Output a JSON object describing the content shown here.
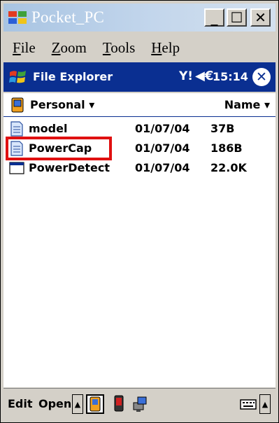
{
  "window": {
    "title": "Pocket_PC",
    "minimize_glyph": "_",
    "maximize_glyph": "☐",
    "close_glyph": "✕"
  },
  "menu": {
    "items": [
      {
        "label": "File",
        "mnemonic": "F",
        "rest": "ile"
      },
      {
        "label": "Zoom",
        "mnemonic": "Z",
        "rest": "oom"
      },
      {
        "label": "Tools",
        "mnemonic": "T",
        "rest": "ools"
      },
      {
        "label": "Help",
        "mnemonic": "H",
        "rest": "elp"
      }
    ]
  },
  "navbar": {
    "title": "File Explorer",
    "signal_glyph": "Y!",
    "volume_glyph": "◀€",
    "time": "15:14",
    "close_glyph": "✕"
  },
  "explorer": {
    "folder": "Personal ▾",
    "sort": "Name ▾",
    "files": [
      {
        "name": "model",
        "date": "01/07/04",
        "size": "37B",
        "icon": "document-icon"
      },
      {
        "name": "PowerCap",
        "date": "01/07/04",
        "size": "186B",
        "icon": "document-icon"
      },
      {
        "name": "PowerDetect",
        "date": "01/07/04",
        "size": "22.0K",
        "icon": "application-icon"
      }
    ]
  },
  "commandbar": {
    "edit": "Edit",
    "open": "Open",
    "up_arrow": "▲"
  },
  "colors": {
    "nav_blue": "#0a2f91",
    "highlight_red": "#e01010",
    "chrome_gray": "#d4d0c8"
  }
}
